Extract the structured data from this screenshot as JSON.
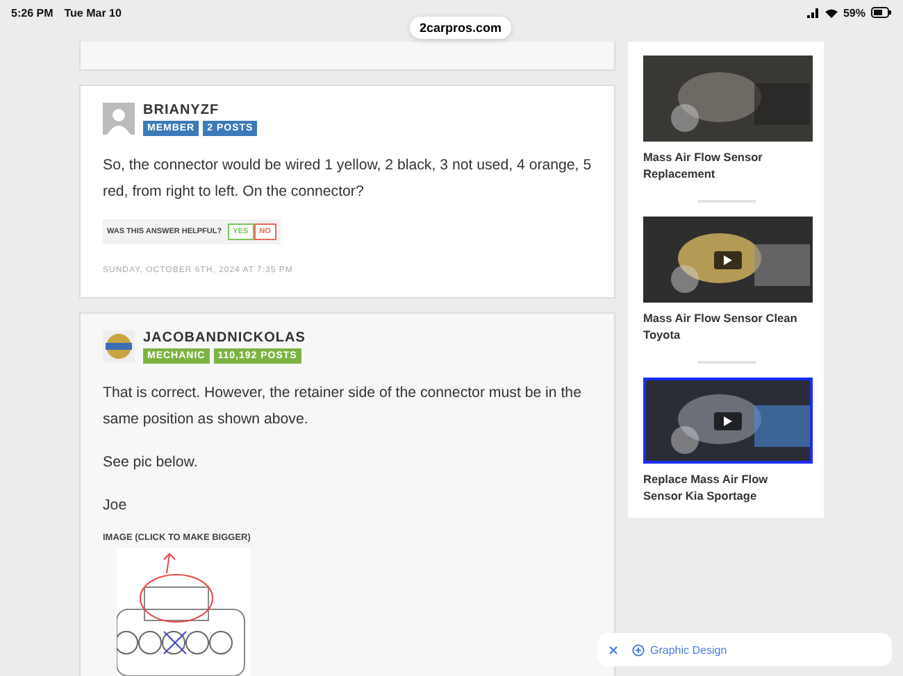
{
  "status_bar": {
    "time": "5:26 PM",
    "date": "Tue Mar 10",
    "battery": "59%"
  },
  "url_pill": "2carpros.com",
  "posts": [
    {
      "username": "BRIANYZF",
      "avatar": {
        "kind": "silhouette"
      },
      "badges": [
        {
          "label": "MEMBER",
          "color": "#3d7ab8"
        },
        {
          "label": "2 POSTS",
          "color": "#3d7ab8"
        }
      ],
      "paragraphs": [
        "So, the connector would be wired 1 yellow, 2 black, 3 not used, 4 orange, 5 red, from right to left. On the connector?"
      ],
      "helpful": {
        "question": "WAS THIS ANSWER HELPFUL?",
        "yes": "YES",
        "no": "NO"
      },
      "date": "SUNDAY, OCTOBER 6TH, 2024 AT 7:35 PM"
    },
    {
      "username": "JACOBANDNICKOLAS",
      "avatar": {
        "kind": "expert"
      },
      "badges": [
        {
          "label": "MECHANIC",
          "color": "#7cb342"
        },
        {
          "label": "110,192 POSTS",
          "color": "#7cb342"
        }
      ],
      "paragraphs": [
        "That is correct. However, the retainer side of the connector must be in the same position as shown above.",
        "See pic below.",
        "Joe"
      ],
      "image_caption": "IMAGE (CLICK TO MAKE BIGGER)"
    }
  ],
  "sidebar": {
    "videos": [
      {
        "title": "Mass Air Flow Sensor Replacement",
        "play": false,
        "framed": false
      },
      {
        "title": "Mass Air Flow Sensor Clean Toyota",
        "play": true,
        "framed": false
      },
      {
        "title": "Replace Mass Air Flow Sensor Kia Sportage",
        "play": true,
        "framed": true
      }
    ]
  },
  "suggestion_bar": {
    "label": "Graphic Design"
  }
}
